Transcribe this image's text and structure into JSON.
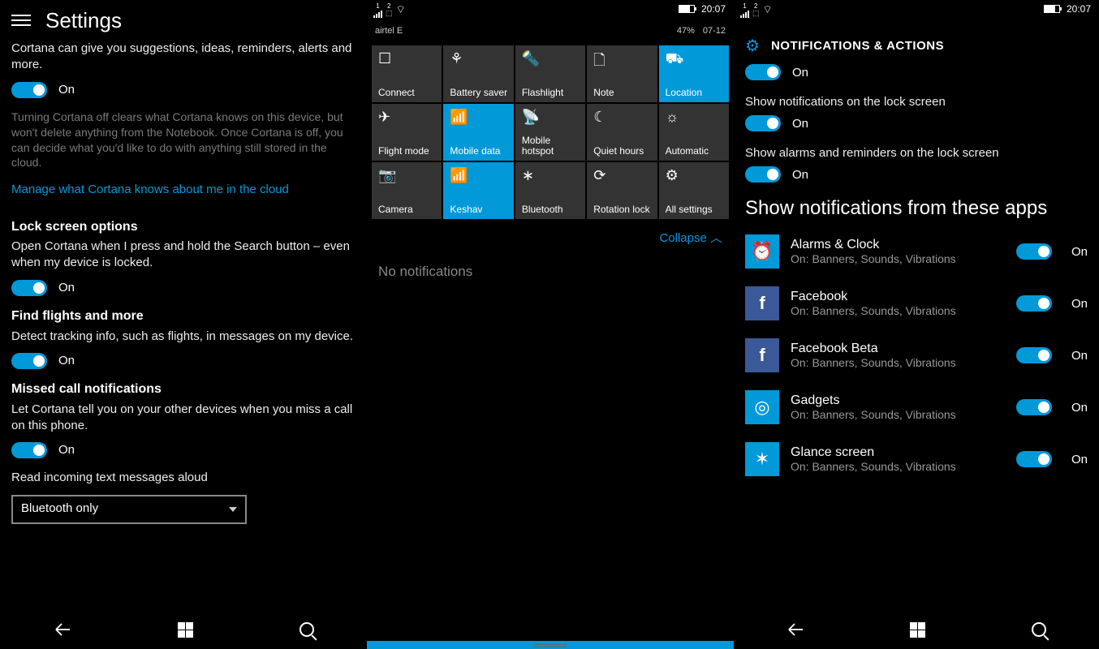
{
  "accent": "#0299d8",
  "panel1": {
    "title": "Settings",
    "intro": "Cortana can give you suggestions, ideas, reminders, alerts and more.",
    "toggle_on": "On",
    "off_note": "Turning Cortana off clears what Cortana knows on this device, but won't delete anything from the Notebook. Once Cortana is off, you can decide what you'd like to do with anything still stored in the cloud.",
    "cloud_link": "Manage what Cortana knows about me in the cloud",
    "lock": {
      "title": "Lock screen options",
      "desc": "Open Cortana when I press and hold the Search button – even when my device is locked.",
      "state": "On"
    },
    "flights": {
      "title": "Find flights and more",
      "desc": "Detect tracking info, such as flights, in messages on my device.",
      "state": "On"
    },
    "missed": {
      "title": "Missed call notifications",
      "desc": "Let Cortana tell you on your other devices when you miss a call on this phone.",
      "state": "On"
    },
    "read_aloud_label": "Read incoming text messages aloud",
    "read_aloud_value": "Bluetooth only"
  },
  "panel2": {
    "time": "20:07",
    "carrier": "airtel E",
    "battery_pct": "47%",
    "date": "07-12",
    "tiles": [
      [
        {
          "icon": "connect-icon",
          "glyph": "☐",
          "label": "Connect",
          "active": false
        },
        {
          "icon": "battery-saver-icon",
          "glyph": "⚘",
          "label": "Battery saver",
          "active": false
        },
        {
          "icon": "flashlight-icon",
          "glyph": "🔦",
          "label": "Flashlight",
          "active": false
        },
        {
          "icon": "note-icon",
          "glyph": "🗋",
          "label": "Note",
          "active": false
        },
        {
          "icon": "location-icon",
          "glyph": "⛟",
          "label": "Location",
          "active": true
        }
      ],
      [
        {
          "icon": "flight-mode-icon",
          "glyph": "✈",
          "label": "Flight mode",
          "active": false
        },
        {
          "icon": "mobile-data-icon",
          "glyph": "📶",
          "label": "Mobile data",
          "active": true
        },
        {
          "icon": "hotspot-icon",
          "glyph": "📡",
          "label": "Mobile hotspot",
          "active": false
        },
        {
          "icon": "quiet-hours-icon",
          "glyph": "☾",
          "label": "Quiet hours",
          "active": false
        },
        {
          "icon": "brightness-icon",
          "glyph": "☼",
          "label": "Automatic",
          "active": false
        }
      ],
      [
        {
          "icon": "camera-icon",
          "glyph": "📷",
          "label": "Camera",
          "active": false
        },
        {
          "icon": "wifi-icon",
          "glyph": "📶",
          "label": "Keshav",
          "active": true
        },
        {
          "icon": "bluetooth-icon",
          "glyph": "∗",
          "label": "Bluetooth",
          "active": false
        },
        {
          "icon": "rotation-lock-icon",
          "glyph": "⟳",
          "label": "Rotation lock",
          "active": false
        },
        {
          "icon": "all-settings-icon",
          "glyph": "⚙",
          "label": "All settings",
          "active": false
        }
      ]
    ],
    "collapse": "Collapse",
    "no_notifications": "No notifications"
  },
  "panel3": {
    "time": "20:07",
    "header": "NOTIFICATIONS & ACTIONS",
    "opt1_state": "On",
    "opt2_label": "Show notifications on the lock screen",
    "opt2_state": "On",
    "opt3_label": "Show alarms and reminders on the lock screen",
    "opt3_state": "On",
    "section": "Show notifications from these apps",
    "apps": [
      {
        "icon": "alarms-icon",
        "glyph": "⏰",
        "cls": "",
        "name": "Alarms & Clock",
        "sub": "On: Banners, Sounds, Vibrations",
        "state": "On"
      },
      {
        "icon": "facebook-icon",
        "glyph": "f",
        "cls": "fb",
        "name": "Facebook",
        "sub": "On: Banners, Sounds, Vibrations",
        "state": "On"
      },
      {
        "icon": "facebook-beta-icon",
        "glyph": "f",
        "cls": "fb",
        "name": "Facebook Beta",
        "sub": "On: Banners, Sounds, Vibrations",
        "state": "On"
      },
      {
        "icon": "gadgets-icon",
        "glyph": "◎",
        "cls": "",
        "name": "Gadgets",
        "sub": "On: Banners, Sounds, Vibrations",
        "state": "On"
      },
      {
        "icon": "glance-icon",
        "glyph": "✶",
        "cls": "",
        "name": "Glance screen",
        "sub": "On: Banners, Sounds, Vibrations",
        "state": "On"
      }
    ]
  }
}
